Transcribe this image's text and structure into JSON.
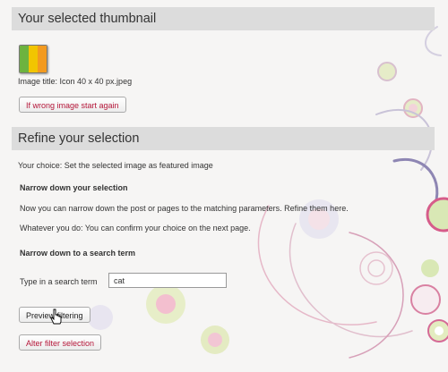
{
  "section1": {
    "header": "Your selected thumbnail",
    "image_title": "Image title: Icon 40 x 40 px.jpeg",
    "restart_button": "If wrong image start again"
  },
  "section2": {
    "header": "Refine your selection",
    "choice_text": "Your choice: Set the selected image as featured image",
    "narrow_heading": "Narrow down your selection",
    "narrow_desc": "Now you can narrow down the post or pages to the matching parameters. Refine them here.",
    "confirm_desc": "Whatever you do: You can confirm your choice on the next page.",
    "search_heading": "Narrow down to a search term",
    "search_label": "Type in a search term",
    "search_value": "cat",
    "preview_button": "Preview filtering",
    "alter_button": "Alter filter selection"
  },
  "colors": {
    "accent_red": "#b5173a",
    "header_bg": "#dcdcdc",
    "thumb_stripes": [
      "#6db33f",
      "#f2c500",
      "#f39a1f"
    ]
  },
  "icons": [
    "thumbnail-image",
    "hand-pointer-cursor"
  ]
}
